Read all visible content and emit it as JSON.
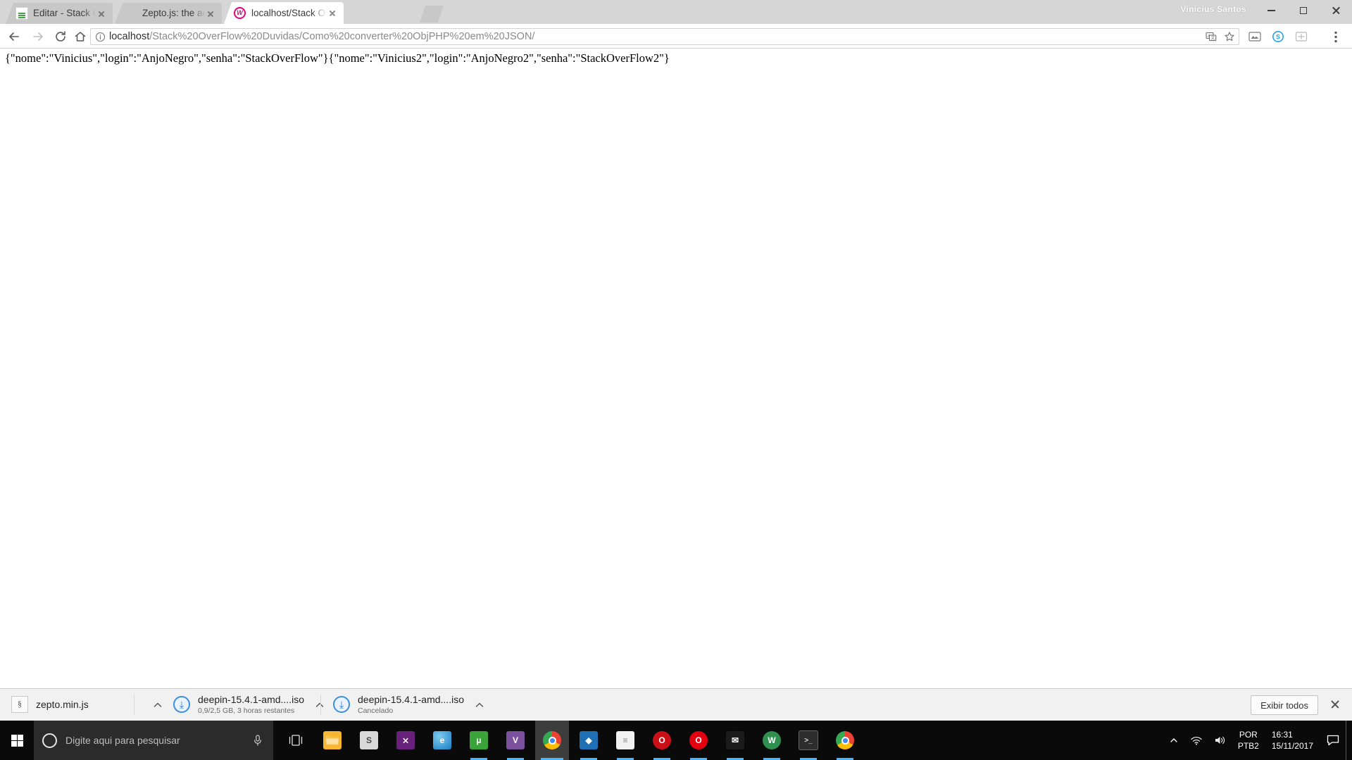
{
  "window": {
    "user_label": "Vinicius Santos",
    "minimize_label": "Minimizar",
    "maximize_label": "Maximizar",
    "close_label": "Fechar"
  },
  "tabs": [
    {
      "title": "Editar - Stack Overflow e",
      "favicon": "stackoverflow-icon",
      "active": false,
      "close_label": "Fechar guia"
    },
    {
      "title": "Zepto.js: the aerogel-wei",
      "favicon": "zeptojs-icon",
      "active": false,
      "close_label": "Fechar guia"
    },
    {
      "title": "localhost/Stack OverFlow",
      "favicon": "wampserver-icon",
      "active": true,
      "close_label": "Fechar guia"
    }
  ],
  "newtab": {
    "label": "Nova guia"
  },
  "toolbar": {
    "back_label": "Voltar",
    "forward_label": "Avançar",
    "reload_label": "Recarregar esta página",
    "home_label": "Página inicial",
    "omnibox": {
      "info_icon": "page-info-icon",
      "scheme_host": "localhost",
      "path": "/Stack%20OverFlow%20Duvidas/Como%20converter%20ObjPHP%20em%20JSON/",
      "translate_icon": "translate-icon",
      "bookmark_icon": "star-icon"
    },
    "extensions": [
      {
        "name": "extension-icon-1"
      },
      {
        "name": "skype-extension-icon"
      },
      {
        "name": "extension-icon-3"
      }
    ],
    "menu_label": "Personalizar e controlar o Google Chrome"
  },
  "page": {
    "body_text": "{\"nome\":\"Vinicius\",\"login\":\"AnjoNegro\",\"senha\":\"StackOverFlow\"}{\"nome\":\"Vinicius2\",\"login\":\"AnjoNegro2\",\"senha\":\"StackOverFlow2\"}"
  },
  "downloads_shelf": {
    "items": [
      {
        "filename": "zepto.min.js",
        "status": "",
        "icon": "js-file-icon",
        "menu_label": "Mostrar mais opções"
      },
      {
        "filename": "deepin-15.4.1-amd....iso",
        "status": "0,9/2,5 GB, 3 horas restantes",
        "icon": "download-progress-icon",
        "menu_label": "Mostrar mais opções"
      },
      {
        "filename": "deepin-15.4.1-amd....iso",
        "status": "Cancelado",
        "icon": "download-icon",
        "menu_label": "Mostrar mais opções"
      }
    ],
    "show_all_label": "Exibir todos",
    "close_label": "Fechar"
  },
  "taskbar": {
    "start_label": "Iniciar",
    "search_placeholder": "Digite aqui para pesquisar",
    "cortana_icon": "cortana-circle-icon",
    "mic_icon": "microphone-icon",
    "taskview_label": "Visão de tarefas",
    "apps": [
      {
        "name": "file-explorer-icon",
        "glyph": "▤",
        "bg": "#f0b429",
        "running": false
      },
      {
        "name": "visual-studio-icon",
        "glyph": "∞",
        "bg": "#68217a",
        "running": false
      },
      {
        "name": "internet-explorer-icon",
        "glyph": "e",
        "bg": "#1b8ed0",
        "running": false
      },
      {
        "name": "sublime-text-icon",
        "glyph": "S",
        "bg": "#d8d8d8",
        "running": false
      },
      {
        "name": "utorrent-icon",
        "glyph": "µ",
        "bg": "#3aa33a",
        "running": true
      },
      {
        "name": "viber-icon",
        "glyph": "V",
        "bg": "#7b519d",
        "running": false
      },
      {
        "name": "google-chrome-icon",
        "glyph": "●",
        "bg": "#4285f4",
        "running": true,
        "active": true
      },
      {
        "name": "vscode-icon",
        "glyph": "⬡",
        "bg": "#1f6fb5",
        "running": true
      },
      {
        "name": "notepad-icon",
        "glyph": "☰",
        "bg": "#f2f2f2",
        "running": true
      },
      {
        "name": "opera-icon",
        "glyph": "O",
        "bg": "#cc0f16",
        "running": true
      },
      {
        "name": "opera-beta-icon",
        "glyph": "O",
        "bg": "#e3000f",
        "running": true
      },
      {
        "name": "mail-icon",
        "glyph": "✉",
        "bg": "#2b2b2b",
        "running": true
      },
      {
        "name": "wampserver-icon",
        "glyph": "W",
        "bg": "#2f8f4f",
        "running": true
      },
      {
        "name": "terminal-icon",
        "glyph": "▣",
        "bg": "#2d2d2d",
        "running": true
      },
      {
        "name": "chrome-window-icon",
        "glyph": "●",
        "bg": "#4285f4",
        "running": true
      }
    ],
    "tray": {
      "overflow_icon": "show-hidden-icons-icon",
      "network_icon": "wifi-icon",
      "volume_icon": "speaker-icon",
      "language_line1": "POR",
      "language_line2": "PTB2",
      "time": "16:31",
      "date": "15/11/2017",
      "action_center_icon": "action-center-icon"
    }
  }
}
